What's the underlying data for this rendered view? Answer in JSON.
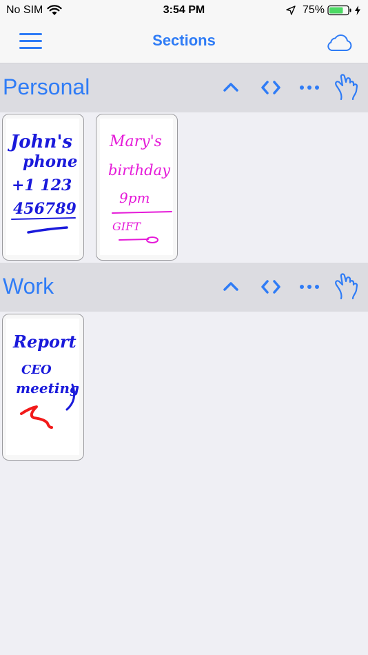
{
  "status_bar": {
    "carrier": "No SIM",
    "time": "3:54 PM",
    "battery_percent": "75%",
    "battery_level": 0.75
  },
  "nav": {
    "title": "Sections",
    "menu_icon": "hamburger-icon",
    "cloud_icon": "cloud-icon"
  },
  "colors": {
    "accent": "#2f7cf6",
    "ink_blue": "#1a1adb",
    "ink_magenta": "#e51ad8",
    "ink_red": "#f21a1a",
    "battery_green": "#4cd964"
  },
  "sections": [
    {
      "title": "Personal",
      "action_icons": [
        "chevron-up-icon",
        "code-brackets-icon",
        "more-icon",
        "hand-pointer-icon"
      ],
      "notes": [
        {
          "handwriting": [
            "John's",
            "phone",
            "+1 123",
            "456789"
          ],
          "ink": "blue"
        },
        {
          "handwriting": [
            "Mary's",
            "birthday",
            "9pm",
            "GIFT"
          ],
          "ink": "magenta"
        }
      ]
    },
    {
      "title": "Work",
      "action_icons": [
        "chevron-up-icon",
        "code-brackets-icon",
        "more-icon",
        "hand-pointer-icon"
      ],
      "notes": [
        {
          "handwriting": [
            "Report",
            "CEO",
            "meeting"
          ],
          "ink": "blue-red"
        }
      ]
    }
  ]
}
